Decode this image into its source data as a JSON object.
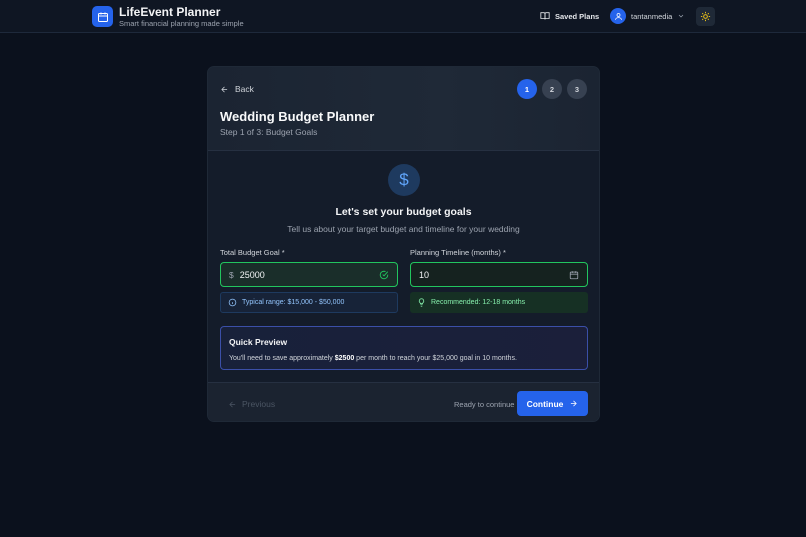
{
  "header": {
    "app_title": "LifeEvent Planner",
    "app_subtitle": "Smart financial planning made simple",
    "saved_plans": "Saved Plans",
    "username": "tantanmedia",
    "logo_icon": "calendar-icon",
    "theme_icon": "sun-icon"
  },
  "card": {
    "back_label": "Back",
    "steps": [
      "1",
      "2",
      "3"
    ],
    "active_step": 1,
    "title": "Wedding Budget Planner",
    "step_label": "Step 1 of 3: Budget Goals",
    "section_title": "Let's set your budget goals",
    "section_subtitle": "Tell us about your target budget and timeline for your wedding",
    "budget": {
      "label": "Total Budget Goal *",
      "prefix": "$",
      "value": "25000",
      "hint": "Typical range: $15,000 - $50,000"
    },
    "timeline": {
      "label": "Planning Timeline (months) *",
      "value": "10",
      "hint": "Recommended: 12-18 months"
    },
    "preview": {
      "title": "Quick Preview",
      "text_before": "You'll need to save approximately ",
      "amount": "$2500",
      "text_after": " per month to reach your $25,000 goal in 10 months."
    },
    "footer": {
      "previous": "Previous",
      "ready": "Ready to continue",
      "continue": "Continue"
    }
  },
  "colors": {
    "accent": "#2563eb",
    "success": "#22c55e",
    "background": "#0b111d"
  }
}
